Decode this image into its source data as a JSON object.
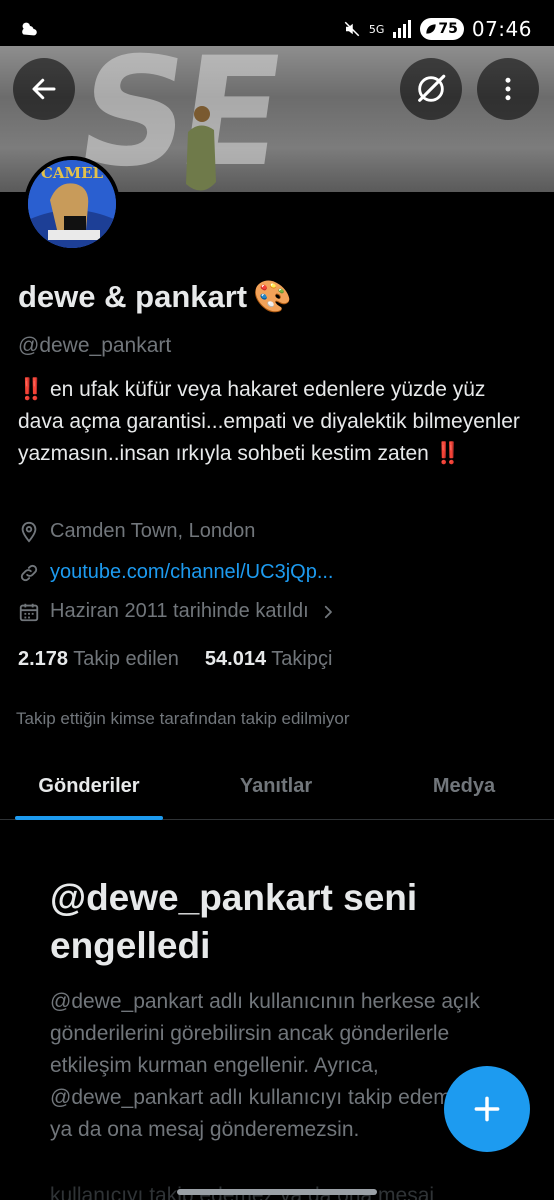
{
  "status_bar": {
    "network": "5G",
    "battery": "75",
    "time": "07:46"
  },
  "banner": {
    "graffiti_text": "SE"
  },
  "avatar": {
    "text": "CAMEL"
  },
  "profile": {
    "name": "dewe & pankart",
    "name_emoji": "🎨",
    "handle": "@dewe_pankart",
    "bio_bang": "‼️",
    "bio_text": " en ufak küfür veya hakaret edenlere yüzde yüz dava açma garantisi...empati ve diyalektik bilmeyenler yazmasın..insan ırkıyla sohbeti kestim zaten ",
    "location": "Camden Town, London",
    "link": "youtube.com/channel/UC3jQp...",
    "joined": "Haziran 2011 tarihinde katıldı",
    "following_count": "2.178",
    "following_label": "Takip edilen",
    "followers_count": "54.014",
    "followers_label": "Takipçi",
    "not_followed_note": "Takip ettiğin kimse tarafından takip edilmiyor"
  },
  "tabs": [
    {
      "label": "Gönderiler",
      "active": true
    },
    {
      "label": "Yanıtlar",
      "active": false
    },
    {
      "label": "Medya",
      "active": false
    }
  ],
  "blocked": {
    "title": "@dewe_pankart seni engelledi",
    "text": "@dewe_pankart adlı kullanıcının herkese açık gönderilerini görebilirsin ancak gönderilerle etkileşim kurman engellenir. Ayrıca, @dewe_pankart adlı kullanıcıyı takip edemez ya da ona mesaj gönderemezsin.",
    "cut_off_line": "kullanıcıyı takip edemez ya da ona mesaj"
  },
  "colors": {
    "accent": "#1d9bf0",
    "background": "#000000",
    "secondary_text": "#71767b",
    "alert": "#f4212e"
  },
  "icons": {
    "back": "arrow-left-icon",
    "grok": "grok-icon",
    "more": "more-vertical-icon",
    "location": "location-pin-icon",
    "link": "link-icon",
    "calendar": "calendar-icon",
    "chevron": "chevron-right-icon",
    "compose": "plus-icon"
  }
}
